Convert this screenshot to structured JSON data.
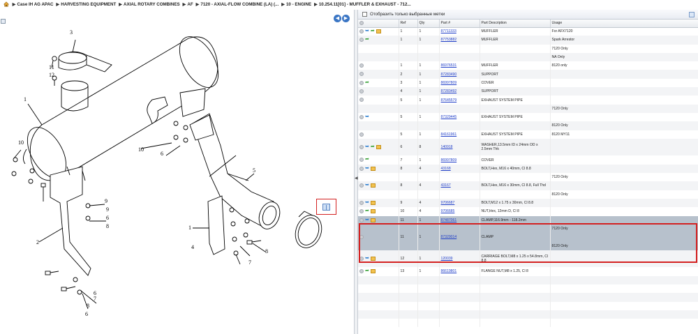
{
  "breadcrumb": {
    "items": [
      "Case IH AG APAC",
      "HARVESTING EQUIPMENT",
      "AXIAL ROTARY COMBINES",
      "AF",
      "7120 - AXIAL-FLOW COMBINE (LA) (...",
      "10 - ENGINE",
      "10.254.11[01] - MUFFLER & EXHAUST - 712..."
    ],
    "separator": "▶"
  },
  "diagram": {
    "callouts": [
      "3",
      "11",
      "12",
      "1",
      "10",
      "10",
      "6",
      "9",
      "6",
      "8",
      "9",
      "2",
      "5",
      "1",
      "4",
      "7",
      "8",
      "6",
      "7",
      "8",
      "6"
    ]
  },
  "toolbar": {
    "filter_label": "Отобразить только выбранные метки"
  },
  "columns": [
    "Ref",
    "Qty",
    "Part #",
    "Part Description",
    "Usage"
  ],
  "rows": [
    {
      "icons": [
        "circle",
        "back",
        "forward",
        "box"
      ],
      "ref": "1",
      "qty": "1",
      "part": "87711333",
      "desc": "MUFFLER",
      "usage": "For AFX7120"
    },
    {
      "icons": [
        "circle",
        "forward"
      ],
      "ref": "1",
      "qty": "1",
      "part": "87753882",
      "desc": "MUFFLER",
      "usage": "Spark Arrestor"
    },
    {
      "icons": [],
      "ref": "",
      "qty": "",
      "part": "",
      "desc": "",
      "usage": "7120 Only"
    },
    {
      "icons": [],
      "ref": "",
      "qty": "",
      "part": "",
      "desc": "",
      "usage": "NA Only"
    },
    {
      "icons": [
        "circle"
      ],
      "ref": "1",
      "qty": "1",
      "part": "86976531",
      "desc": "MUFFLER",
      "usage": "8120 only"
    },
    {
      "icons": [
        "circle"
      ],
      "ref": "2",
      "qty": "1",
      "part": "87283490",
      "desc": "SUPPORT",
      "usage": ""
    },
    {
      "icons": [
        "circle",
        "forward"
      ],
      "ref": "3",
      "qty": "1",
      "part": "86997809",
      "desc": "COVER",
      "usage": ""
    },
    {
      "icons": [
        "circle"
      ],
      "ref": "4",
      "qty": "1",
      "part": "87283492",
      "desc": "SUPPORT",
      "usage": ""
    },
    {
      "icons": [
        "circle"
      ],
      "ref": "5",
      "qty": "1",
      "part": "87645579",
      "desc": "EXHAUST SYSTEM PIPE",
      "usage": ""
    },
    {
      "icons": [],
      "ref": "",
      "qty": "",
      "part": "",
      "desc": "",
      "usage": "7120 Only"
    },
    {
      "icons": [
        "circle",
        "back"
      ],
      "ref": "5",
      "qty": "1",
      "part": "87329445",
      "desc": "EXHAUST SYSTEM PIPE",
      "usage": ""
    },
    {
      "icons": [],
      "ref": "",
      "qty": "",
      "part": "",
      "desc": "",
      "usage": "8120 Only"
    },
    {
      "icons": [
        "circle"
      ],
      "ref": "5",
      "qty": "1",
      "part": "84161961",
      "desc": "EXHAUST SYSTEM PIPE",
      "usage": "8120 MY11"
    },
    {
      "icons": [
        "circle",
        "back",
        "forward",
        "box"
      ],
      "ref": "6",
      "qty": "8",
      "part": "140918",
      "desc": "WASHER,13.5mm ID x 24mm OD x 2.5mm Thk",
      "usage": "",
      "tall": true
    },
    {
      "icons": [
        "circle",
        "forward"
      ],
      "ref": "7",
      "qty": "1",
      "part": "86997809",
      "desc": "COVER",
      "usage": ""
    },
    {
      "icons": [
        "circle",
        "back",
        "box"
      ],
      "ref": "8",
      "qty": "4",
      "part": "43168",
      "desc": "BOLT,Hex, M16 x 40mm, Cl 8.8",
      "usage": ""
    },
    {
      "icons": [],
      "ref": "",
      "qty": "",
      "part": "",
      "desc": "",
      "usage": "7120 Only"
    },
    {
      "icons": [
        "circle",
        "back",
        "box"
      ],
      "ref": "8",
      "qty": "4",
      "part": "43167",
      "desc": "BOLT,Hex, M16 x 30mm, Cl 8.8, Full Thd",
      "usage": ""
    },
    {
      "icons": [],
      "ref": "",
      "qty": "",
      "part": "",
      "desc": "",
      "usage": "8120 Only"
    },
    {
      "icons": [
        "circle",
        "back",
        "box"
      ],
      "ref": "9",
      "qty": "4",
      "part": "9706687",
      "desc": "BOLT,M12 x 1.75 x 30mm, Cl 8.8",
      "usage": ""
    },
    {
      "icons": [
        "circle",
        "forward",
        "box"
      ],
      "ref": "10",
      "qty": "4",
      "part": "9706685",
      "desc": "NUT,Hex, 12mm D, Cl 8",
      "usage": ""
    },
    {
      "icons": [
        "circle",
        "back",
        "box"
      ],
      "ref": "11",
      "qty": "1",
      "part": "87487061",
      "desc": "CLAMP,116.9mm - 118.2mm",
      "usage": "",
      "hl": true
    },
    {
      "icons": [],
      "ref": "",
      "qty": "",
      "part": "",
      "desc": "",
      "usage": "7120 Only",
      "hl": true
    },
    {
      "icons": [
        "circle"
      ],
      "ref": "11",
      "qty": "1",
      "part": "87329014",
      "desc": "CLAMP",
      "usage": "",
      "hl": true
    },
    {
      "icons": [],
      "ref": "",
      "qty": "",
      "part": "",
      "desc": "",
      "usage": "8120 Only",
      "hl": true
    },
    {
      "icons": [
        "circle",
        "back",
        "box"
      ],
      "ref": "12",
      "qty": "1",
      "part": "120039",
      "desc": "CARRIAGE BOLT,M8 x 1.25 x 54.8mm, Cl 8.8",
      "usage": "",
      "tall": true
    },
    {
      "icons": [
        "circle",
        "forward",
        "box"
      ],
      "ref": "13",
      "qty": "1",
      "part": "86619801",
      "desc": "FLANGE NUT,M8 x 1.25, Cl 8",
      "usage": ""
    },
    {
      "icons": [],
      "ref": "",
      "qty": "",
      "part": "",
      "desc": "",
      "usage": ""
    },
    {
      "icons": [],
      "ref": "",
      "qty": "",
      "part": "",
      "desc": "",
      "usage": ""
    },
    {
      "icons": [],
      "ref": "",
      "qty": "",
      "part": "",
      "desc": "",
      "usage": ""
    },
    {
      "icons": [],
      "ref": "",
      "qty": "",
      "part": "",
      "desc": "",
      "usage": ""
    },
    {
      "icons": [],
      "ref": "",
      "qty": "",
      "part": "",
      "desc": "",
      "usage": ""
    },
    {
      "icons": [],
      "ref": "",
      "qty": "",
      "part": "",
      "desc": "",
      "usage": ""
    }
  ]
}
